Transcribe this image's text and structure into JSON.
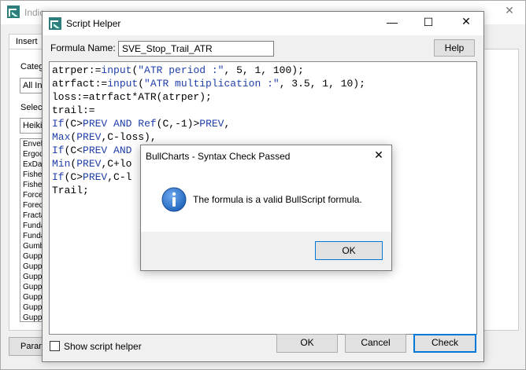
{
  "background_window": {
    "title": "Indic",
    "insert_tab": "Insert",
    "category_label": "Categ",
    "category_value": "All Ind",
    "select_label": "Selec",
    "select_value": "Heikin",
    "list_items": [
      "Envel",
      "Ergod",
      "ExDat",
      "Fisher",
      "Fisher",
      "Force",
      "Forec",
      "Fracta",
      "Funda",
      "Funda",
      "Gumb",
      "Guppy",
      "Guppy",
      "Guppy",
      "Guppy",
      "Guppy",
      "Guppy",
      "Guppy"
    ],
    "param_button": "Param"
  },
  "script_helper": {
    "title": "Script Helper",
    "formula_name_label": "Formula Name:",
    "formula_name_value": "SVE_Stop_Trail_ATR",
    "help_button": "Help",
    "code_lines": [
      "atrper:=input(\"ATR period :\", 5, 1, 100);",
      "atrfact:=input(\"ATR multiplication :\", 3.5, 1, 10);",
      "loss:=atrfact*ATR(atrper);",
      "trail:=",
      "If(C>PREV AND Ref(C,-1)>PREV,",
      "Max(PREV,C-loss),",
      "If(C<PREV AND",
      "Min(PREV,C+lo",
      "If(C>PREV,C-l",
      "Trail;"
    ],
    "show_script_helper_label": "Show script helper",
    "show_script_helper_checked": false,
    "ok_button": "OK",
    "cancel_button": "Cancel",
    "check_button": "Check"
  },
  "dialog": {
    "title": "BullCharts - Syntax Check Passed",
    "message": "The formula is a valid BullScript formula.",
    "ok_button": "OK",
    "icon": "info-icon"
  },
  "colors": {
    "accent_focus": "#0078d7",
    "code_keyword": "#1f3ea8",
    "info_icon": "#1c62b9"
  }
}
